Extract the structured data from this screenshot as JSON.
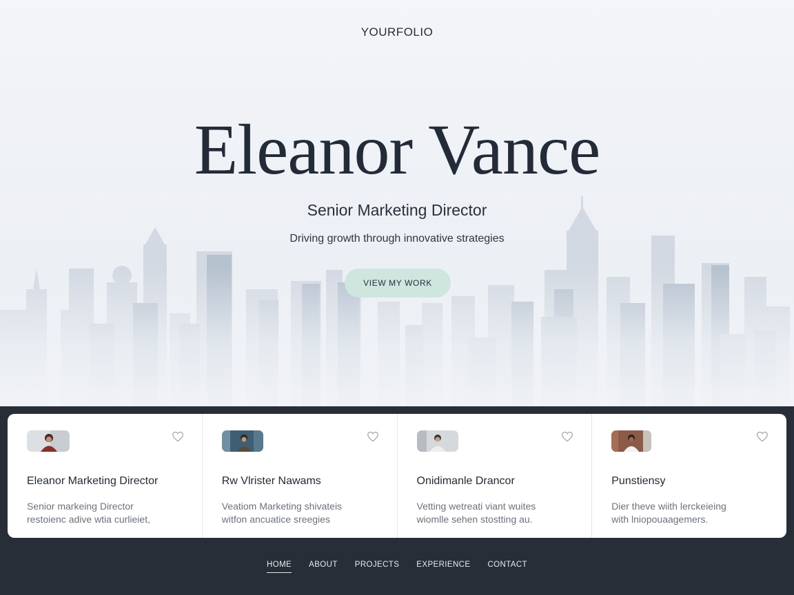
{
  "brand": "YOURFOLIO",
  "hero": {
    "name": "Eleanor Vance",
    "title": "Senior Marketing Director",
    "tagline": "Driving growth through innovative strategies",
    "cta_label": "VIEW MY WORK"
  },
  "cards": [
    {
      "title": "Eleanor Marketing Director",
      "desc_line1": "Senior markeing Director",
      "desc_line2": "restoienc adive wtia curlieiet,"
    },
    {
      "title": "Rw Vlrister Nawams",
      "desc_line1": "Veatiom Marketing shivateis",
      "desc_line2": "witfon ancuatice sreegies"
    },
    {
      "title": "Onidimanle Drancor",
      "desc_line1": "Vetting wetreati viant wuites",
      "desc_line2": "wiomlle sehen stostting au."
    },
    {
      "title": "Punstiensy",
      "desc_line1": "Dier theve wiith lerckeieing",
      "desc_line2": "with lniopouaagemers."
    }
  ],
  "nav": {
    "items": [
      "HOME",
      "ABOUT",
      "PROJECTS",
      "EXPERIENCE",
      "CONTACT"
    ],
    "active": "HOME"
  },
  "colors": {
    "hero_bg": "#eef1f5",
    "footer_bg": "#282e38",
    "cta_bg": "#cfe6de",
    "text_dark": "#232b38"
  }
}
